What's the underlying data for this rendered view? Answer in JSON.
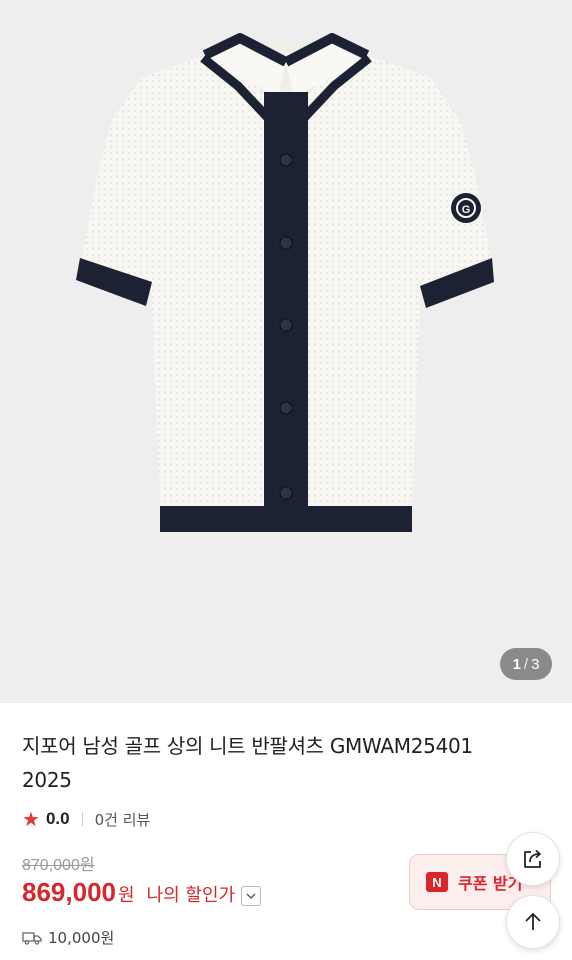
{
  "gallery": {
    "image_alt": "white knit short-sleeve shirt with navy trim",
    "current": "1",
    "separator": "/",
    "total": "3"
  },
  "product": {
    "title": "지포어 남성 골프 상의 니트 반팔셔츠 GMWAM25401 2025",
    "rating_score": "0.0",
    "review_count": "0건 리뷰",
    "original_price": "870,000원",
    "sale_price": "869,000",
    "currency": "원",
    "my_discount_label": "나의 할인가",
    "shipping_fee": "10,000원"
  },
  "coupon": {
    "badge": "N",
    "label": "쿠폰 받기"
  },
  "icons": {
    "star": "star-icon",
    "chevron": "chevron-down-icon",
    "truck": "truck-icon",
    "share": "share-icon",
    "top": "arrow-up-icon"
  },
  "colors": {
    "accent_red": "#d7262c",
    "navy_trim": "#1c2233",
    "shirt_white": "#f7f6f2"
  }
}
